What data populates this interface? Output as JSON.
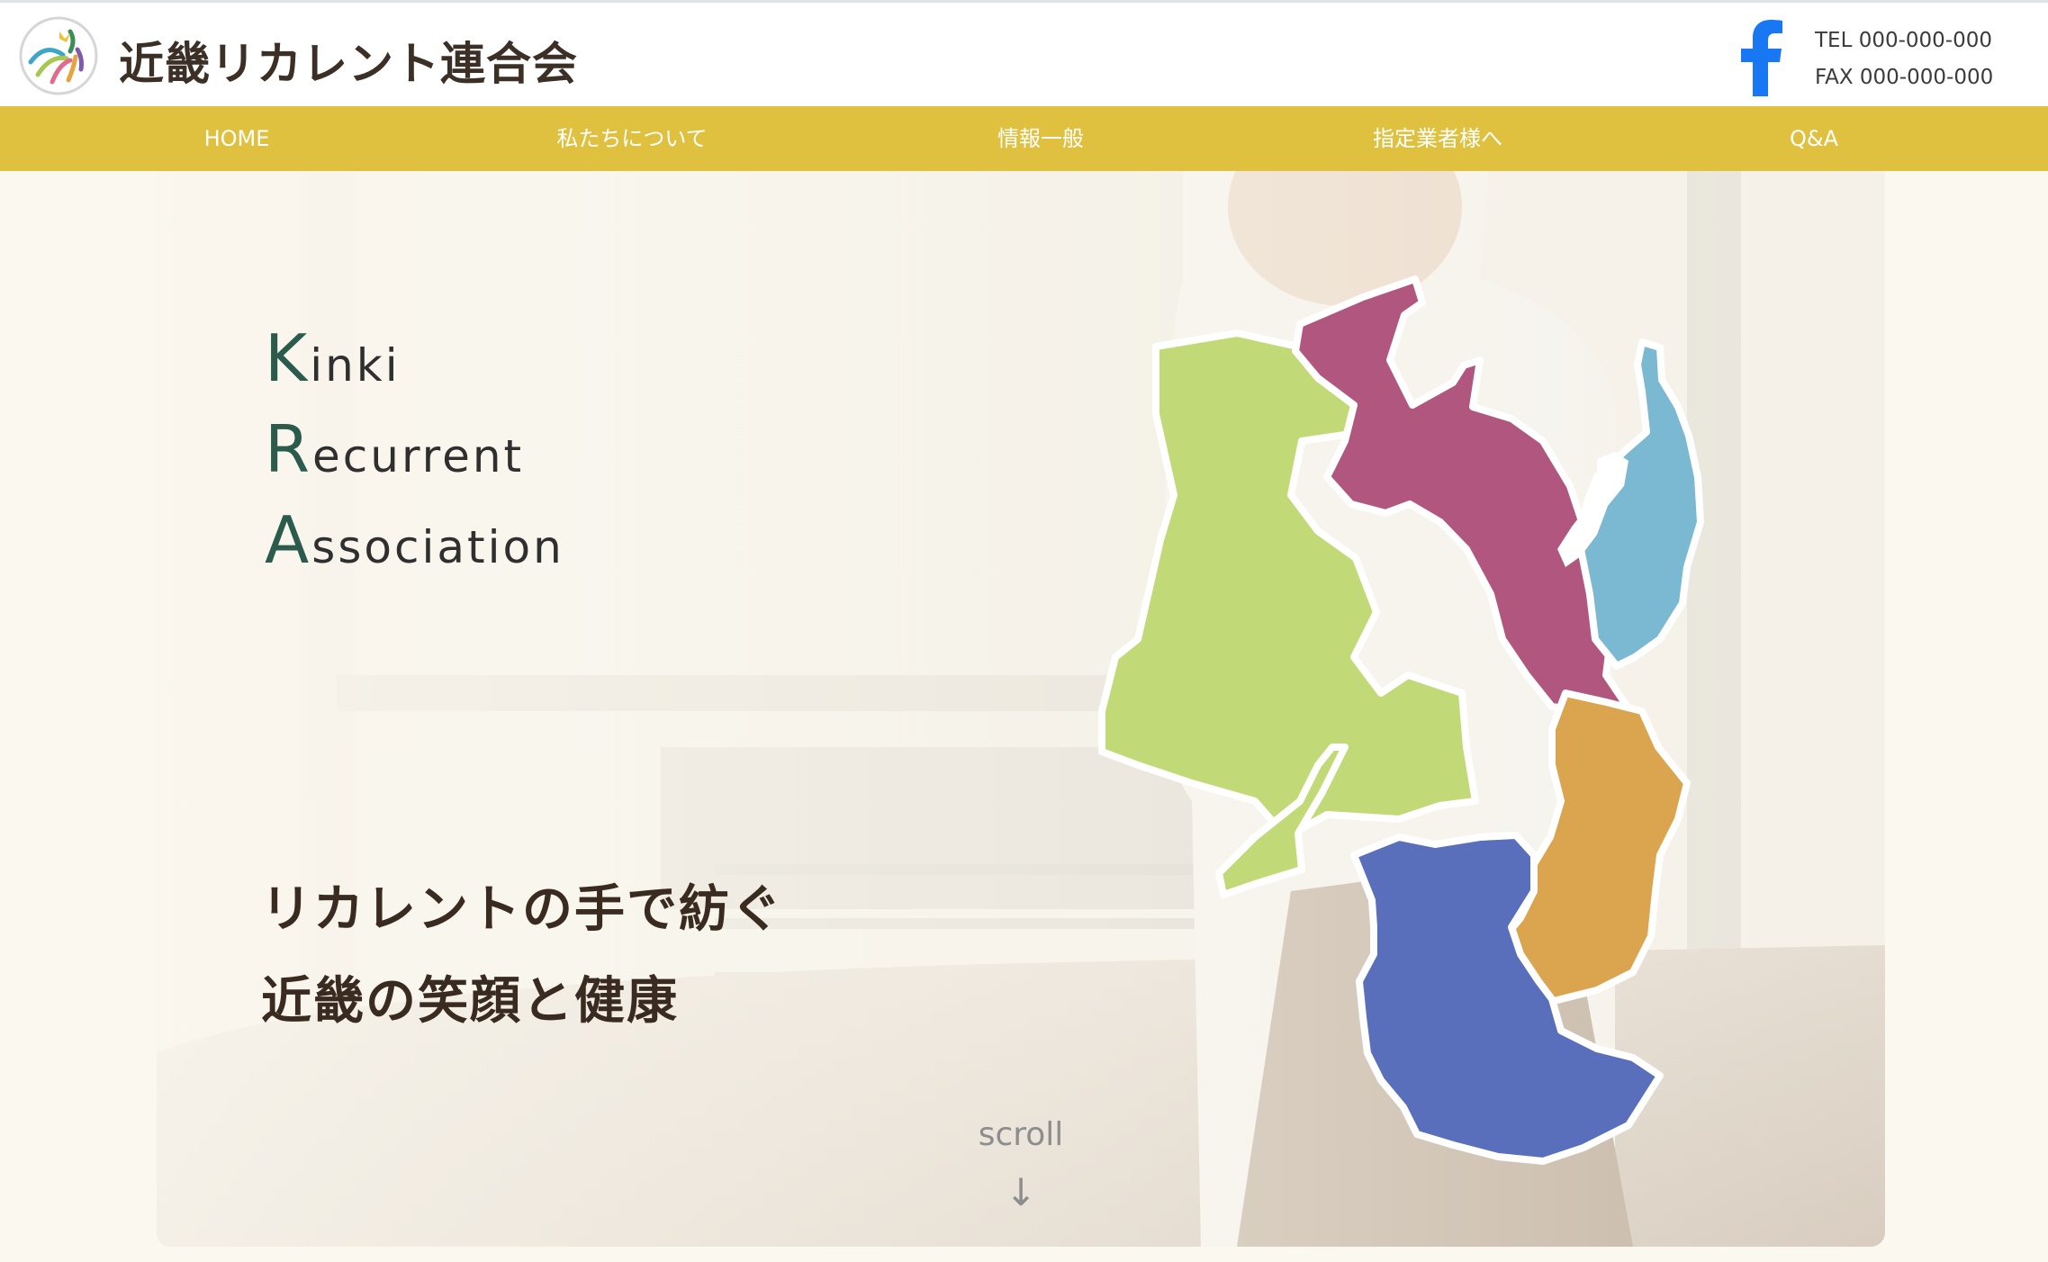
{
  "header": {
    "site_title": "近畿リカレント連合会",
    "logo_icon": "kra-logo-icon",
    "facebook_icon": "facebook-icon",
    "tel": "TEL 000-000-000",
    "fax": "FAX 000-000-000"
  },
  "nav": {
    "items": [
      {
        "label": "HOME"
      },
      {
        "label": "私たちについて"
      },
      {
        "label": "情報一般"
      },
      {
        "label": "指定業者様へ"
      },
      {
        "label": "Q&A"
      }
    ]
  },
  "hero": {
    "tagline": [
      {
        "initial": "K",
        "rest": "inki"
      },
      {
        "initial": "R",
        "rest": "ecurrent"
      },
      {
        "initial": "A",
        "rest": "ssociation"
      }
    ],
    "catch_lines": [
      "リカレントの手で紡ぐ",
      "近畿の笑顔と健康"
    ],
    "scroll_label": "scroll",
    "scroll_arrow": "↓"
  },
  "map": {
    "prefectures": [
      {
        "name": "hyogo",
        "color": "#c2d977"
      },
      {
        "name": "kyoto",
        "color": "#b0567f"
      },
      {
        "name": "shiga",
        "color": "#7bb8d1"
      },
      {
        "name": "nara",
        "color": "#dba54f"
      },
      {
        "name": "wakayama",
        "color": "#5a6fbb"
      }
    ]
  },
  "colors": {
    "nav_bg": "#dfc03f",
    "hero_bg": "#fbf8f0",
    "title_text": "#3b2f26",
    "accent_letter": "#2b5b4d",
    "facebook_blue": "#1877f2"
  }
}
